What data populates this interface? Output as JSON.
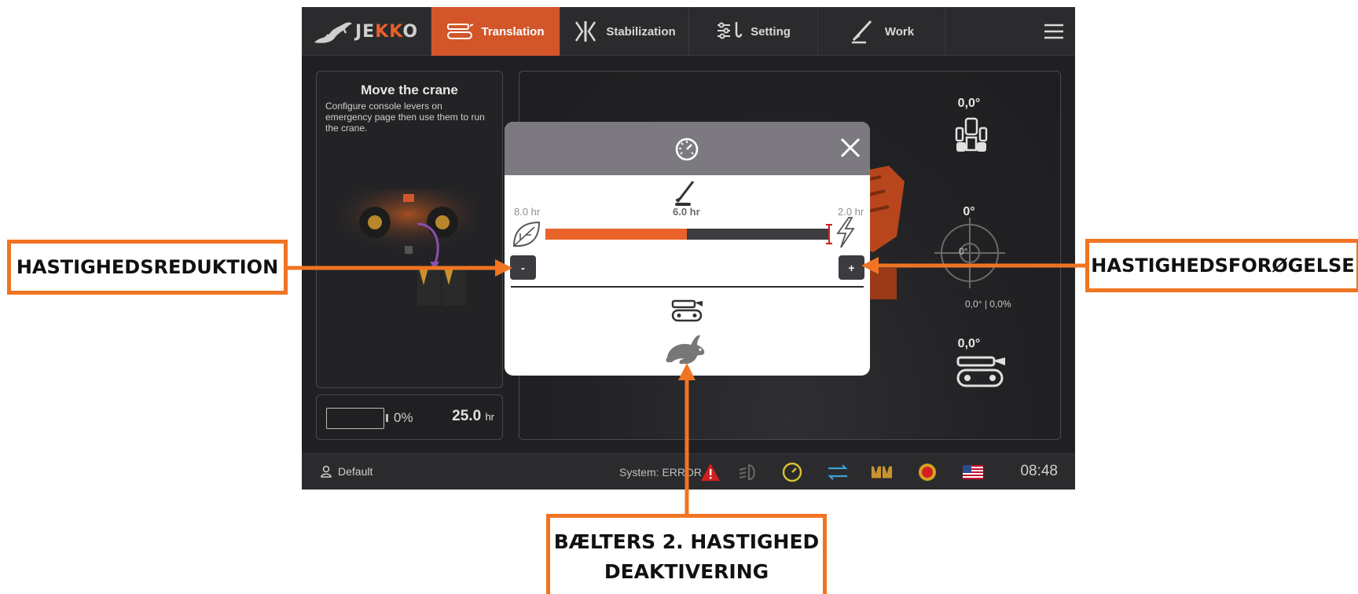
{
  "app": {
    "logo": "JEKKO",
    "tabs": [
      {
        "label": "Translation",
        "icon": "track-icon",
        "active": true
      },
      {
        "label": "Stabilization",
        "icon": "outrigger-icon",
        "active": false
      },
      {
        "label": "Setting",
        "icon": "settings-hook-icon",
        "active": false
      },
      {
        "label": "Work",
        "icon": "boom-icon",
        "active": false
      }
    ],
    "menu_icon": "hamburger-menu-icon"
  },
  "left_panel": {
    "title": "Move the crane",
    "description": "Configure console levers on emergency page then use them to run the crane."
  },
  "battery": {
    "percent": "0%",
    "hours": "25.0",
    "hours_unit": "hr",
    "level": 0
  },
  "readouts": {
    "top_angle": "0,0°",
    "level_angle": "0°",
    "level_center": "0°",
    "level_xy_left": "0,0°",
    "level_xy_right": "0,0%",
    "track_angle": "0,0°"
  },
  "status": {
    "user": "Default",
    "system": "System: ERROR",
    "time": "08:48",
    "accent": "#d2562a",
    "error_color": "#d21f1f"
  },
  "modal": {
    "header_icon": "speedometer-icon",
    "close_icon": "close-icon",
    "left_value": "8.0 hr",
    "mid_value": "6.0 hr",
    "right_value": "2.0 hr",
    "left_icon": "eco-leaf-icon",
    "right_icon": "lightning-icon",
    "speed_fraction": 0.5,
    "minus_label": "-",
    "plus_label": "+",
    "track_icon": "track-icon",
    "hare_icon": "hare-icon"
  },
  "annotations": {
    "left": "HASTIGHEDSREDUKTION",
    "right": "HASTIGHEDSFORØGELSE",
    "bottom_line1": "BÆLTERS 2. HASTIGHED",
    "bottom_line2": "DEAKTIVERING",
    "color": "#f07422"
  }
}
